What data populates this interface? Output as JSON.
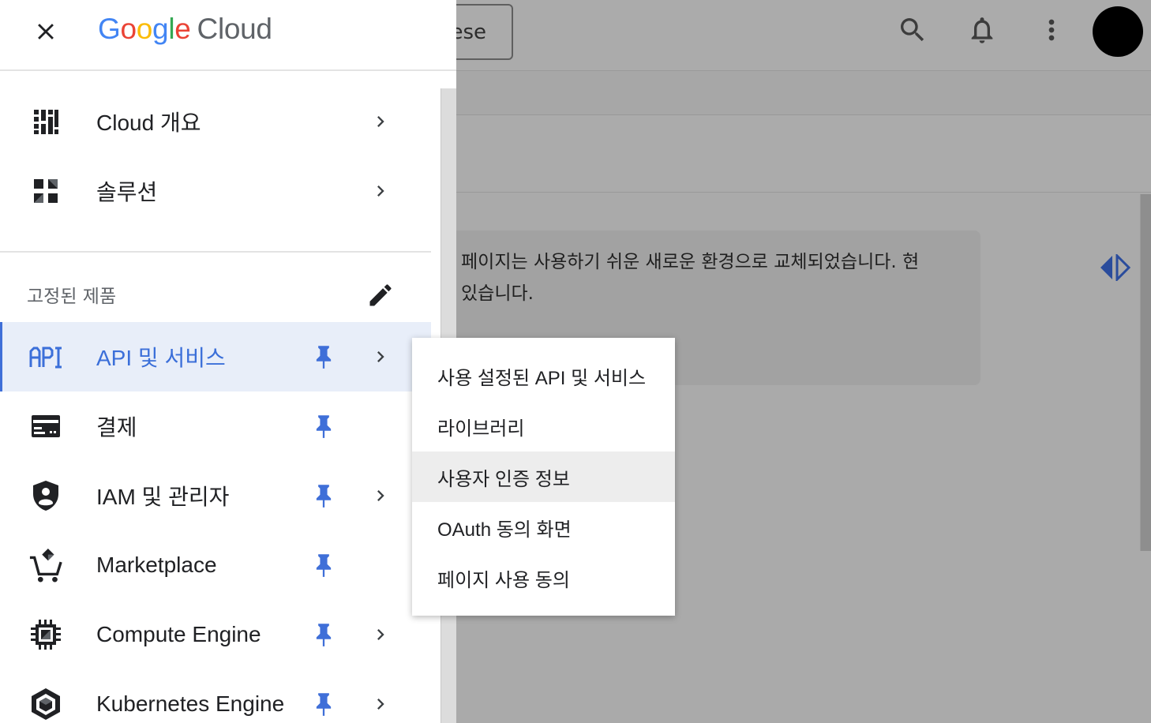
{
  "background": {
    "project_selector_label": "ese",
    "notice_line1": "페이지는 사용하기 쉬운 새로운 환경으로 교체되었습니다. 현",
    "notice_line2": "있습니다."
  },
  "drawer": {
    "logo": {
      "google_letters": [
        "G",
        "o",
        "o",
        "g",
        "l",
        "e"
      ],
      "product": "Cloud"
    },
    "top_items": [
      {
        "label": "Cloud 개요",
        "icon": "dashboard-icon",
        "has_chevron": true
      },
      {
        "label": "솔루션",
        "icon": "solutions-grid-icon",
        "has_chevron": true
      }
    ],
    "pinned_header": "고정된 제품",
    "pinned_items": [
      {
        "label": "API 및 서비스",
        "icon": "api-icon",
        "pinned": true,
        "has_chevron": true,
        "active": true
      },
      {
        "label": "결제",
        "icon": "billing-card-icon",
        "pinned": true,
        "has_chevron": false
      },
      {
        "label": "IAM 및 관리자",
        "icon": "iam-shield-icon",
        "pinned": true,
        "has_chevron": true
      },
      {
        "label": "Marketplace",
        "icon": "marketplace-cart-icon",
        "pinned": true,
        "has_chevron": false
      },
      {
        "label": "Compute Engine",
        "icon": "compute-chip-icon",
        "pinned": true,
        "has_chevron": true
      },
      {
        "label": "Kubernetes Engine",
        "icon": "kubernetes-icon",
        "pinned": true,
        "has_chevron": true
      }
    ]
  },
  "submenu": {
    "items": [
      "사용 설정된 API 및 서비스",
      "라이브러리",
      "사용자 인증 정보",
      "OAuth 동의 화면",
      "페이지 사용 동의"
    ],
    "hovered_index": 2
  },
  "colors": {
    "accent": "#3b6fd9",
    "pin": "#3f6fd8",
    "active_bg": "#e8eef9",
    "scrim": "#aaaaaa"
  }
}
